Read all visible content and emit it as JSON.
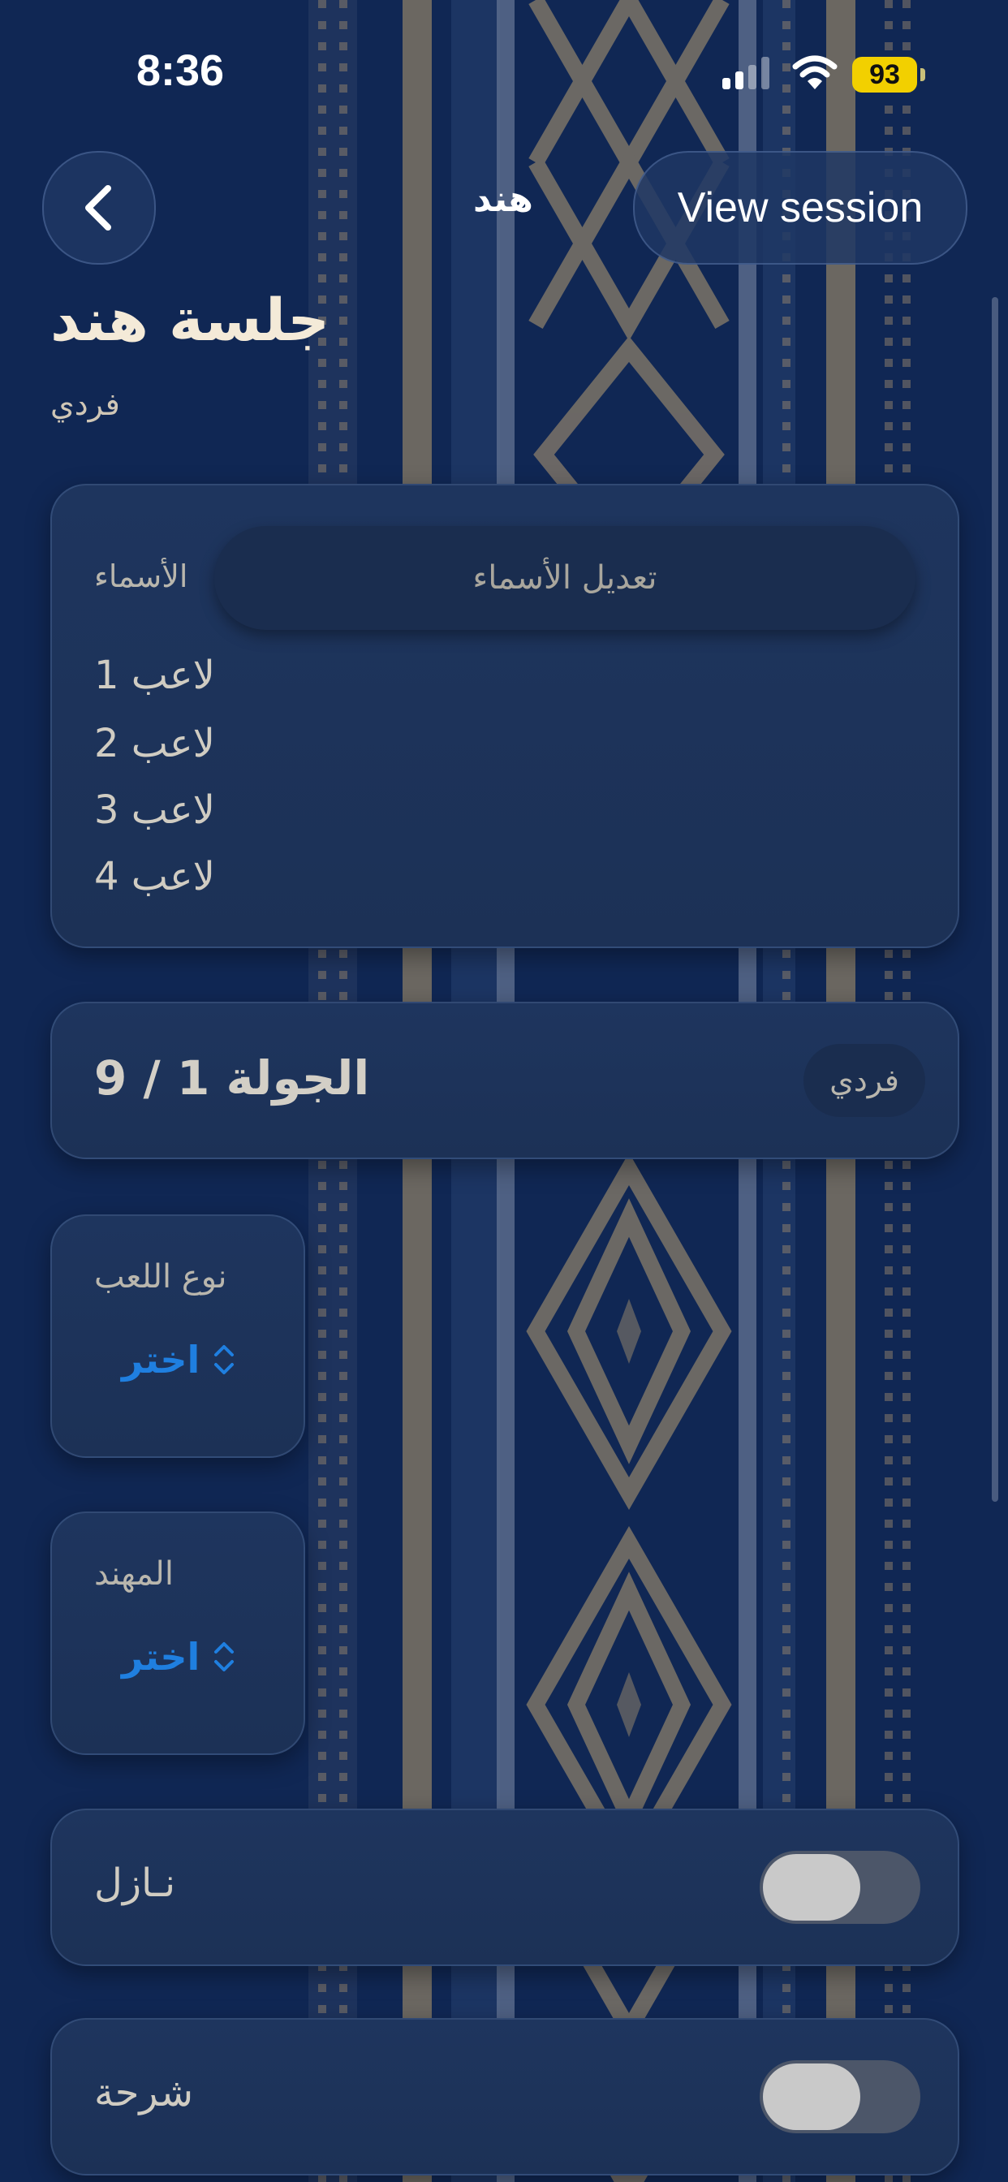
{
  "status_bar": {
    "time": "8:36",
    "battery": "93",
    "signal_icon": "cellular-signal-icon",
    "wifi_icon": "wifi-icon"
  },
  "nav": {
    "back_icon": "chevron-left-icon",
    "title": "هند",
    "view_session_label": "View session"
  },
  "header": {
    "title": "جلسة هند",
    "subtitle": "فردي"
  },
  "names_card": {
    "label": "الأسماء",
    "edit_button": "تعديل الأسماء",
    "players": [
      "لاعب 1",
      "لاعب 2",
      "لاعب 3",
      "لاعب 4"
    ]
  },
  "round_card": {
    "round_text": "الجولة 1 / 9",
    "mode": "فردي"
  },
  "game_type": {
    "label": "نوع اللعب",
    "value": "اختر"
  },
  "weapon": {
    "label": "المهند",
    "value": "اختر"
  },
  "toggles": [
    {
      "label": "نـازل",
      "on": false
    },
    {
      "label": "شرحة",
      "on": false
    }
  ],
  "colors": {
    "background": "#102754",
    "card": "#1e355e",
    "accent_blue": "#1f7fe0",
    "battery": "#f2d000"
  }
}
